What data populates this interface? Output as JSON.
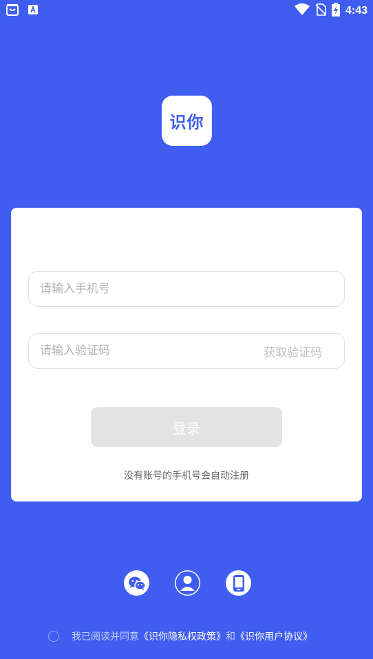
{
  "status_bar": {
    "time": "4:43"
  },
  "logo": {
    "text": "识你"
  },
  "login": {
    "phone_placeholder": "请输入手机号",
    "code_placeholder": "请输入验证码",
    "get_code_label": "获取验证码",
    "login_label": "登录",
    "hint": "没有账号的手机号会自动注册"
  },
  "login_methods": [
    {
      "icon": "wechat-icon"
    },
    {
      "icon": "user-icon"
    },
    {
      "icon": "phone-icon"
    }
  ],
  "agreement": {
    "prefix": "我已阅读并同意",
    "privacy_link": "《识你隐私权政策》",
    "and": "和",
    "user_link": "《识你用户协议》"
  },
  "colors": {
    "background": "#3f5ef0",
    "card": "#ffffff",
    "button_disabled": "#e3e3e3"
  }
}
